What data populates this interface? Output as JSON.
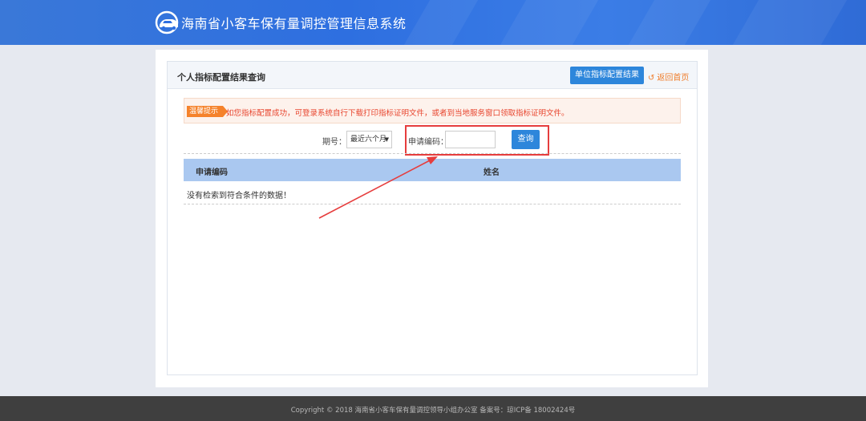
{
  "header": {
    "app_title": "海南省小客车保有量调控管理信息系统",
    "logo_icon": "car-logo-icon"
  },
  "panel": {
    "title": "个人指标配置结果查询",
    "unit_result_button": "单位指标配置结果",
    "back_home_link": "返回首页"
  },
  "notice": {
    "tag": "温馨提示",
    "text": "如您指标配置成功，可登录系统自行下载打印指标证明文件，或者到当地服务窗口领取指标证明文件。"
  },
  "search": {
    "period_label": "期号：",
    "period_selected": "最近六个月",
    "code_label": "申请编码：",
    "code_value": "",
    "query_button": "查询"
  },
  "table": {
    "columns": [
      "申请编码",
      "姓名"
    ],
    "empty_message": "没有检索到符合条件的数据！"
  },
  "footer": {
    "text": "Copyright  © 2018   海南省小客车保有量调控领导小组办公室    备案号：琼ICP备 18002424号"
  },
  "colors": {
    "header_blue": "#2e6fe0",
    "primary_button": "#2d86db",
    "highlight_red": "#e63d3d",
    "table_header": "#aac8f0",
    "notice_orange": "#f5822b"
  }
}
